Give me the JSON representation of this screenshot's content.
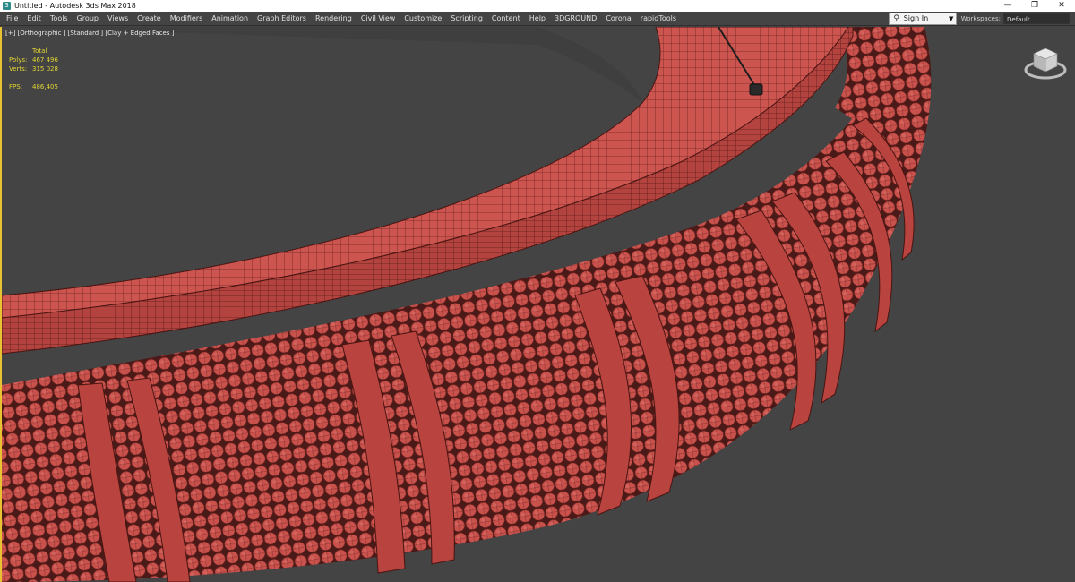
{
  "window": {
    "title": "Untitled - Autodesk 3ds Max 2018",
    "controls": {
      "minimize": "—",
      "maximize": "❐",
      "close": "✕"
    }
  },
  "menu": {
    "items": [
      "File",
      "Edit",
      "Tools",
      "Group",
      "Views",
      "Create",
      "Modifiers",
      "Animation",
      "Graph Editors",
      "Rendering",
      "Civil View",
      "Customize",
      "Scripting",
      "Content",
      "Help",
      "3DGROUND",
      "Corona",
      "rapidTools"
    ],
    "signin_label": "Sign In",
    "workspaces_label": "Workspaces:",
    "workspace_value": "Default"
  },
  "viewport": {
    "label": "[+] [Orthographic ] [Standard ] [Clay + Edged Faces ]",
    "stats": {
      "header": "Total",
      "polys_label": "Polys:",
      "polys_value": "467 496",
      "verts_label": "Verts:",
      "verts_value": "315 028",
      "fps_label": "FPS:",
      "fps_value": "486,405"
    }
  },
  "colors": {
    "accent": "#e8c232",
    "clay": "#c9524d",
    "clay_edge": "#5a1b18",
    "stats_text": "#e3d532",
    "viewport_bg": "#444444"
  }
}
